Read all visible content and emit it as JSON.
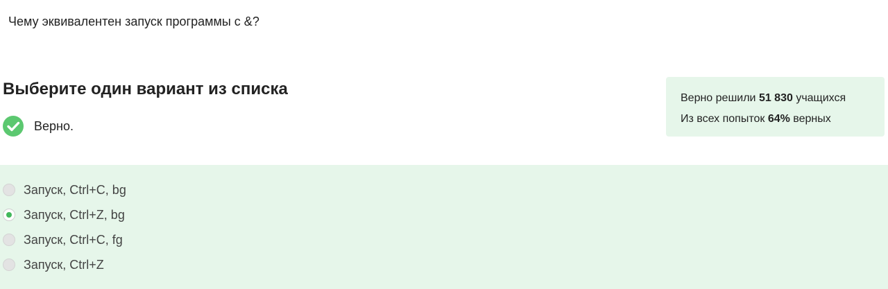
{
  "question": {
    "text": "Чему эквивалентен запуск программы с &?"
  },
  "task": {
    "heading": "Выберите один вариант из списка",
    "result_text": "Верно.",
    "result_icon": "check-circle-icon",
    "result_color": "#5cc870"
  },
  "stats": {
    "solved_prefix": "Верно решили ",
    "solved_count": "51 830",
    "solved_suffix": " учащихся",
    "attempts_prefix": "Из всех попыток ",
    "attempts_percent": "64%",
    "attempts_suffix": " верных"
  },
  "options": [
    {
      "label": "Запуск, Ctrl+C, bg",
      "selected": false
    },
    {
      "label": "Запуск, Ctrl+Z, bg",
      "selected": true
    },
    {
      "label": "Запуск, Ctrl+C, fg",
      "selected": false
    },
    {
      "label": "Запуск, Ctrl+Z",
      "selected": false
    }
  ],
  "colors": {
    "accent_green": "#43b85c",
    "panel_background": "#e6f6ea"
  }
}
